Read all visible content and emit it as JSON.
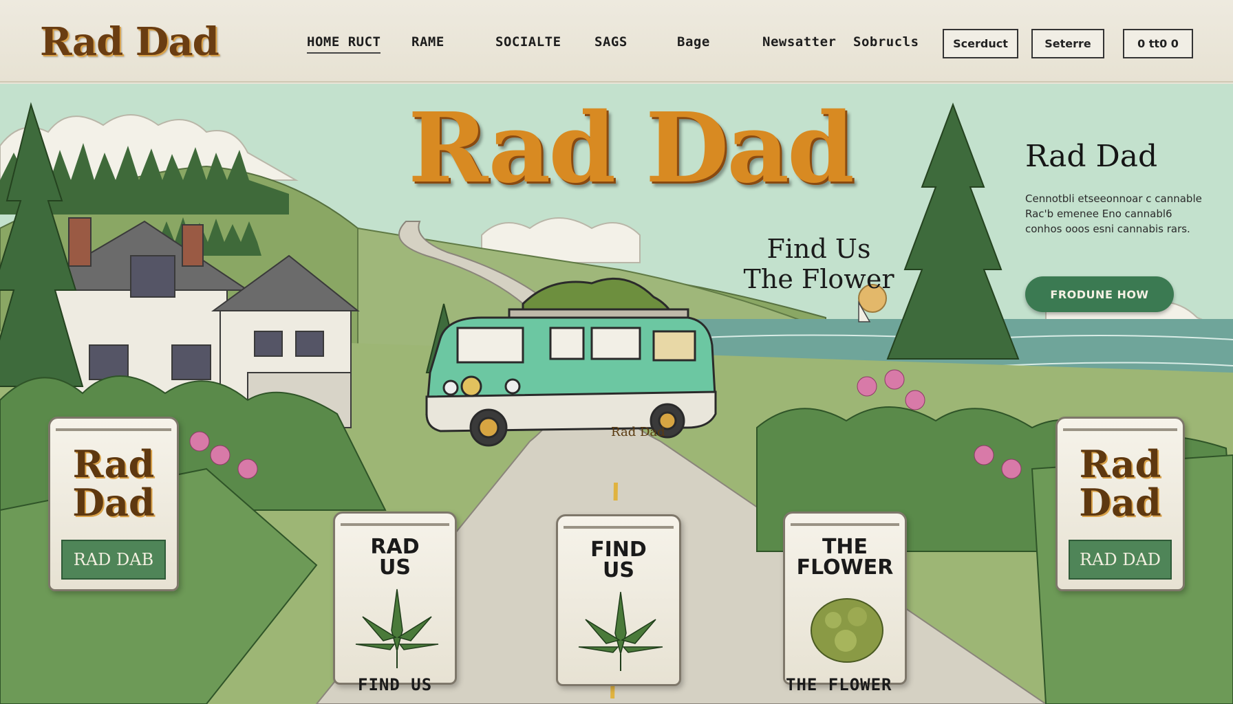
{
  "header": {
    "logo": "Rad Dad",
    "nav": [
      "HOME RUCT",
      "RAME",
      "SOCIALTE",
      "SAGS",
      "Bage",
      "Newsatter",
      "Sobrucls"
    ],
    "buttons": [
      "Scerduct",
      "Seterre",
      "0 tt0 0"
    ]
  },
  "hero": {
    "title": "Rad Dad",
    "subtitle_line1": "Find Us",
    "subtitle_line2": "The Flower",
    "van_text": "Rad Dad"
  },
  "sidebar": {
    "title": "Rad Dad",
    "description": "Cennotbli etseeonnoar c cannable Rac'b emenee Eno cannabl6 conhos ooos esni cannabis rars.",
    "cta_label": "FRODUNE HOW"
  },
  "products": [
    {
      "brand_line1": "Rad",
      "brand_line2": "Dad",
      "strip": "RAD DAB"
    },
    {
      "label_line1": "RAD",
      "label_line2": "US",
      "caption": "FIND US"
    },
    {
      "label_line1": "FIND",
      "label_line2": "US"
    },
    {
      "label_line1": "THE",
      "label_line2": "FLOWER",
      "caption": "THE FLOWER"
    },
    {
      "brand_line1": "Rad",
      "brand_line2": "Dad",
      "strip": "RAD DAD"
    }
  ],
  "colors": {
    "sky": "#bfe0cb",
    "hills": "#8fa86a",
    "ocean": "#6fa59a",
    "van": "#6cc7a2",
    "accent_green": "#3b7a52",
    "gold": "#d88a22",
    "paper": "#e8e4d6"
  }
}
